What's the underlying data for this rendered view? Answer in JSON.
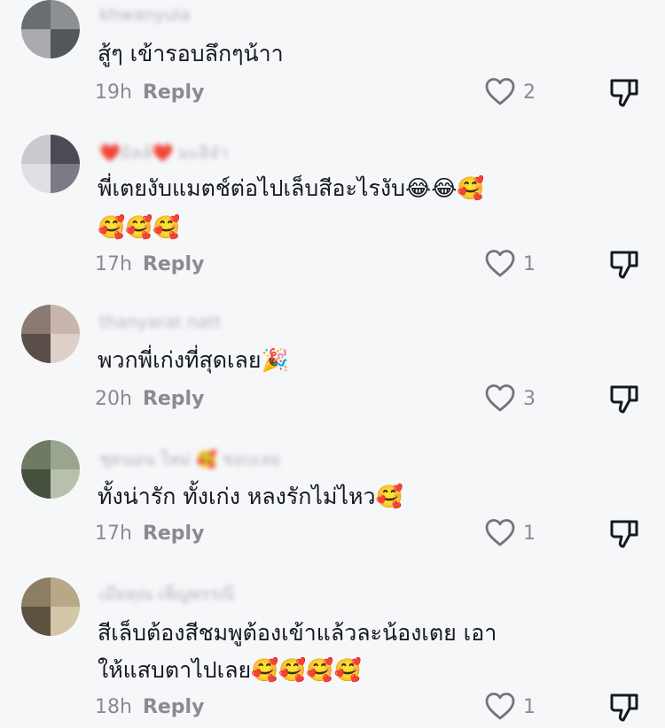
{
  "comments": [
    {
      "username": "khwanyula",
      "text": "สู้ๆ เข้ารอบลึกๆน้าา",
      "text_line2": "",
      "time": "19h",
      "reply": "Reply",
      "likes": "2",
      "avatar_colors": [
        "#6b6e70",
        "#8d8f90",
        "#a9abae",
        "#545759"
      ]
    },
    {
      "username": "❤️มิลล์❤️ มะลิจ๋า",
      "text": "พี่เตยงับแมตช์ต่อไปเล็บสีอะไรงับ😂😂🥰",
      "text_line2": "🥰🥰🥰",
      "time": "17h",
      "reply": "Reply",
      "likes": "1",
      "avatar_colors": [
        "#c9c9cf",
        "#4b4a55",
        "#e1dfe3",
        "#7c7a86"
      ]
    },
    {
      "username": "thanyarat natt",
      "text": "พวกพี่เก่งที่สุดเลย🎉",
      "text_line2": "",
      "time": "20h",
      "reply": "Reply",
      "likes": "3",
      "avatar_colors": [
        "#8a7a72",
        "#c9b5ab",
        "#5b4d47",
        "#ddd0c8"
      ]
    },
    {
      "username": "ชุดนอน ใหม่ 🥰 ชอบเลย",
      "text": "ทั้งน่ารัก ทั้งเก่ง หลงรักไม่ไหว🥰",
      "text_line2": "",
      "time": "17h",
      "reply": "Reply",
      "likes": "1",
      "avatar_colors": [
        "#6f7a63",
        "#9aa590",
        "#46503e",
        "#b7bfad"
      ]
    },
    {
      "username": "เมียคุณ เพ็ญพรรณี",
      "text": "สีเล็บต้องสีชมพูต้องเข้าแล้วละน้องเตย เอา",
      "text_line2": "ให้แสบตาไปเลย🥰🥰🥰🥰",
      "time": "18h",
      "reply": "Reply",
      "likes": "1",
      "avatar_colors": [
        "#8c7d63",
        "#b8a888",
        "#5d5240",
        "#d4c6a8"
      ]
    }
  ]
}
